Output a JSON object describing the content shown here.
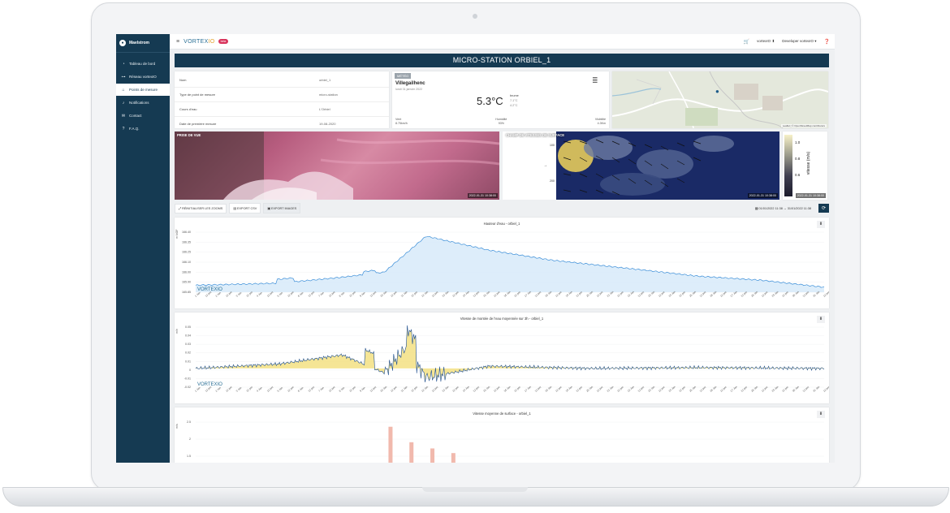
{
  "app": {
    "name": "Maelstrom"
  },
  "sidebar": {
    "items": [
      {
        "label": "Tableau de bord",
        "icon": "dashboard-icon"
      },
      {
        "label": "Réseau vortexIO",
        "icon": "network-icon"
      },
      {
        "label": "Points de mesure",
        "icon": "marker-icon",
        "active": true
      },
      {
        "label": "Notifications",
        "icon": "bell-icon"
      },
      {
        "label": "Contact",
        "icon": "mail-icon"
      },
      {
        "label": "F.A.Q.",
        "icon": "help-icon"
      }
    ]
  },
  "topbar": {
    "logo": "VORTEX",
    "logo_suffix": "IO",
    "badge": "beta",
    "account": "vortexIO",
    "user": "Developer vortexIO"
  },
  "page": {
    "title": "MICRO-STATION ORBIEL_1"
  },
  "info": {
    "rows": [
      {
        "label": "Nom",
        "value": "orbiel_1"
      },
      {
        "label": "Type de point de mesure",
        "value": "micro-station"
      },
      {
        "label": "Cours d'eau",
        "value": "L'Orbiel"
      },
      {
        "label": "Date de première mesure",
        "value": "19-08-2020"
      }
    ]
  },
  "meteo": {
    "tag": "MÉTÉO",
    "city": "Villegailhenc",
    "date": "lundi 31 janvier 2022",
    "temp": "5.3°C",
    "condition": "brume",
    "max": "7.1°C",
    "min": "4.2°C",
    "wind_label": "Vent",
    "wind_value": "8.75km/h",
    "humidity_label": "Humidité",
    "humidity_value": "93%",
    "visibility_label": "Visibilité",
    "visibility_value": "4.3Km"
  },
  "map": {
    "attribution": "Leaflet | © OpenStreetMap contributors"
  },
  "media": {
    "photo_caption": "PRISE DE VUE",
    "photo_ts": "2022-01-31 10:38:00",
    "flow_caption": "CHAMP DE VITESSES DE SURFACE",
    "flow_ts": "2022-01-31 10:38:00",
    "colorbar_label": "vitesse (m/s)",
    "colorbar_ticks": [
      "1.0",
      "0.8",
      "0.6"
    ],
    "colorbar_ts": "2022-01-31 10:38:00"
  },
  "toolbar": {
    "reset": "RÉINITIALISER LES ZOOMS",
    "csv": "EXPORT CSV",
    "images": "EXPORT IMAGES",
    "range": "01/01/2022 11:38 → 31/01/2022 11:38"
  },
  "charts": {
    "c1": {
      "title": "Hauteur d'eau - orbiel_1",
      "unit": "m NGF",
      "yticks": [
        "166.40",
        "166.35",
        "166.25",
        "166.10",
        "166.00",
        "165.90",
        "165.85"
      ]
    },
    "c2": {
      "title": "Vitesse de montée de l'eau moyennée sur 3h - orbiel_1",
      "unit": "m/h",
      "yticks": [
        "0.05",
        "0.04",
        "0.03",
        "0.02",
        "0.01",
        "0",
        "-0.01",
        "-0.02"
      ]
    },
    "c3": {
      "title": "Vitesse moyenne de surface - orbiel_1",
      "unit": "m/s",
      "yticks": [
        "2.5",
        "2",
        "1.5"
      ]
    }
  },
  "chart_data": [
    {
      "type": "area",
      "title": "Hauteur d'eau - orbiel_1",
      "ylabel": "m NGF",
      "ylim": [
        165.82,
        166.42
      ],
      "x": [
        "01 Jan",
        "05 Jan",
        "08 Jan",
        "10 Jan",
        "12 Jan",
        "15 Jan",
        "18 Jan",
        "22 Jan",
        "25 Jan",
        "28 Jan",
        "31 Jan"
      ],
      "values": [
        165.89,
        165.91,
        165.97,
        166.02,
        166.38,
        166.24,
        166.14,
        166.05,
        165.98,
        165.94,
        165.87
      ]
    },
    {
      "type": "line",
      "title": "Vitesse de montée de l'eau moyennée sur 3h - orbiel_1",
      "ylabel": "m/h",
      "ylim": [
        -0.025,
        0.055
      ],
      "x": [
        "01 Jan",
        "05 Jan",
        "08 Jan",
        "10 Jan",
        "11 Jan",
        "12 Jan",
        "15 Jan",
        "20 Jan",
        "25 Jan",
        "31 Jan"
      ],
      "values": [
        0,
        0.01,
        0.03,
        -0.01,
        0.045,
        -0.02,
        0.005,
        0,
        0.002,
        0
      ]
    },
    {
      "type": "bar",
      "title": "Vitesse moyenne de surface - orbiel_1",
      "ylabel": "m/s",
      "ylim": [
        1.3,
        2.6
      ],
      "x": [
        "10 Jan",
        "11 Jan",
        "12 Jan",
        "13 Jan"
      ],
      "values": [
        2.45,
        1.95,
        1.75,
        1.6
      ]
    }
  ]
}
